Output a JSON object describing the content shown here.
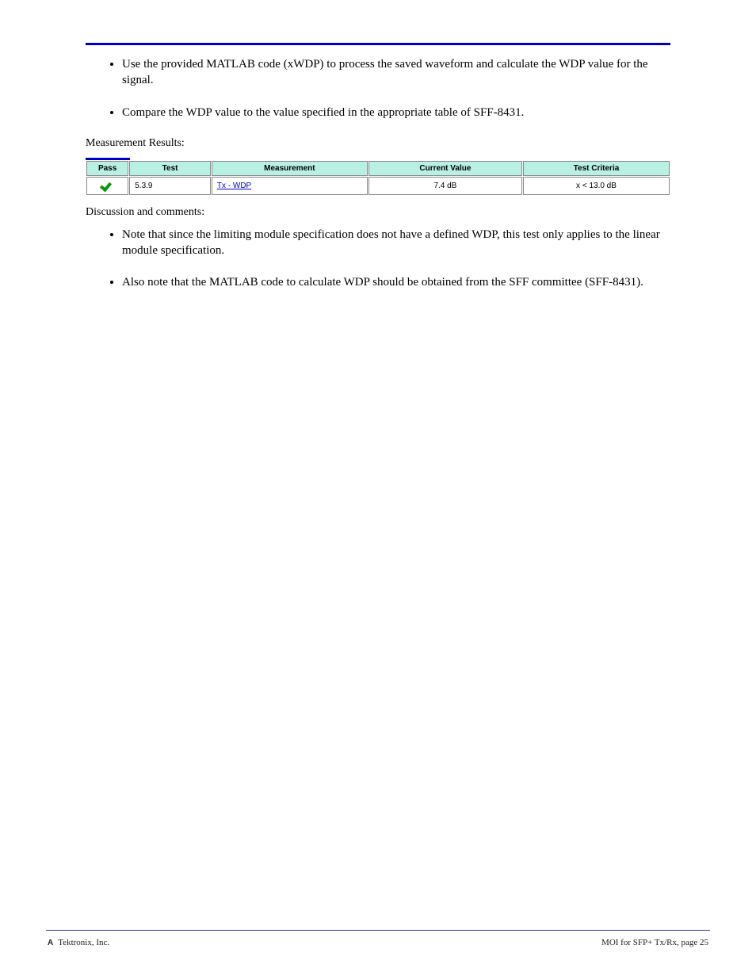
{
  "bullets_group_a": [
    "Use the provided MATLAB code (xWDP) to process the saved waveform and calculate the WDP value for the signal.",
    "Compare the WDP value to the value specified in the appropriate table of SFF-8431."
  ],
  "heading_a": "Measurement Results:",
  "table": {
    "headers": {
      "pass": "Pass",
      "test": "Test",
      "measurement": "Measurement",
      "current_value": "Current Value",
      "test_criteria": "Test Criteria"
    },
    "rows": [
      {
        "pass_icon": "pass-icon",
        "test": "5.3.9",
        "measurement_label": "Tx - WDP",
        "measurement_href": "#",
        "current_value": "7.4 dB",
        "test_criteria": "x < 13.0 dB"
      }
    ]
  },
  "heading_b": "Discussion and comments:",
  "bullets_group_b": [
    "Note that since the limiting module specification does not have a defined WDP, this test only applies to the linear module specification.",
    "Also note that the MATLAB code to calculate WDP should be obtained from the SFF committee (SFF-8431)."
  ],
  "footer": {
    "brand_mark": "A",
    "company": "Tektronix, Inc.",
    "page_info": "MOI for SFP+ Tx/Rx, page 25"
  }
}
